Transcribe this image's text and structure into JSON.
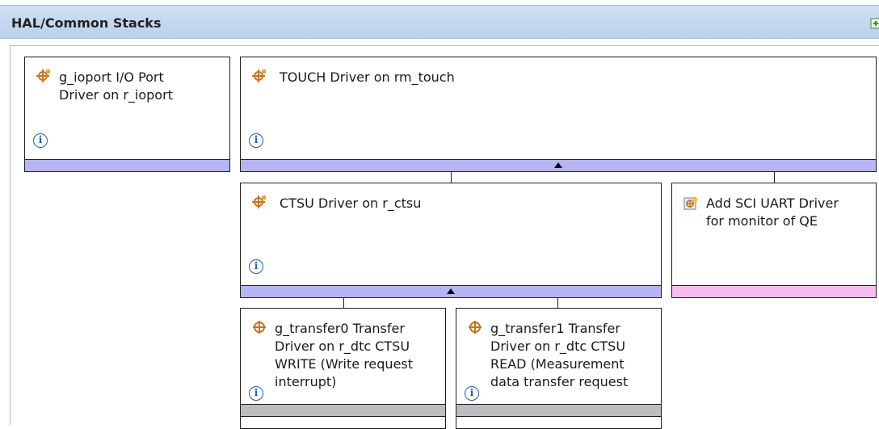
{
  "header": {
    "title": "HAL/Common Stacks"
  },
  "modules": {
    "ioport": {
      "title_line1": "g_ioport I/O Port",
      "title_line2": "Driver on r_ioport",
      "info": "i"
    },
    "touch": {
      "title": "TOUCH Driver on rm_touch",
      "info": "i"
    },
    "ctsu": {
      "title": "CTSU Driver on r_ctsu",
      "info": "i"
    },
    "sci": {
      "title_line1": "Add SCI UART Driver",
      "title_line2": "for monitor of QE"
    },
    "transfer0": {
      "line1": "g_transfer0 Transfer",
      "line2": "Driver on r_dtc CTSU",
      "line3": "WRITE (Write request",
      "line4": "interrupt)",
      "info": "i"
    },
    "transfer1": {
      "line1": "g_transfer1 Transfer",
      "line2": "Driver on r_dtc CTSU",
      "line3": "READ (Measurement",
      "line4": "data transfer request",
      "info": "i"
    }
  },
  "colors": {
    "header": "#b9d2ec",
    "bar_purple": "#b6b4f3",
    "bar_pink": "#f7bdf0",
    "bar_gray": "#bdbdbd",
    "info": "#1f5fb0",
    "icon": "#c8741e"
  },
  "icons": {
    "module": "module-icon",
    "add": "add-module-icon",
    "info": "info-icon",
    "expand": "collapse-arrow-icon"
  }
}
